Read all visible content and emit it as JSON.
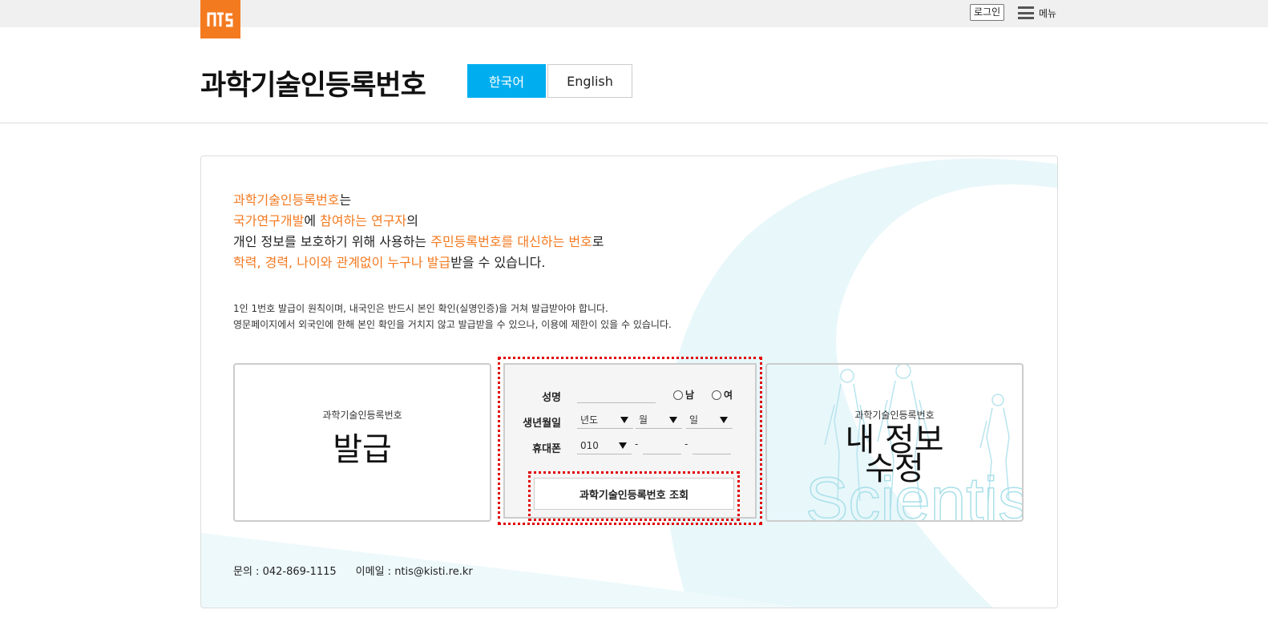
{
  "topbar": {
    "logo_text": "nTiS",
    "login_label": "로그인",
    "menu_label": "메뉴"
  },
  "header": {
    "title": "과학기술인등록번호",
    "lang_ko": "한국어",
    "lang_en": "English"
  },
  "intro": {
    "line1_highlight": "과학기술인등록번호",
    "line1_rest": "는",
    "line2_h1": "국가연구개발",
    "line2_t1": "에 ",
    "line2_h2": "참여하는 연구자",
    "line2_t2": "의",
    "line3_t1": "개인 정보를 보호하기 위해 사용하는 ",
    "line3_h1": "주민등록번호를 대신하는 번호",
    "line3_t2": "로",
    "line4_h1": "학력, 경력, 나이와 관계없이 누구나 발급",
    "line4_t1": "받을 수 있습니다."
  },
  "notice": {
    "line1": "1인 1번호 발급이 원칙이며, 내국인은 반드시 본인 확인(실명인증)을 거쳐 발급받아야 합니다.",
    "line2": "영문페이지에서 외국인에 한해 본인 확인을 거치지 않고 발급받을 수 있으나, 이용에 제한이 있을 수 있습니다."
  },
  "issue_box": {
    "small": "과학기술인등록번호",
    "big": "발급"
  },
  "form": {
    "name_label": "성명",
    "name_value": "",
    "gender_male": "남",
    "gender_female": "여",
    "birth_label": "생년월일",
    "birth_year": "년도",
    "birth_month": "월",
    "birth_day": "일",
    "phone_label": "휴대폰",
    "phone_prefix": "010",
    "phone_sep": "-",
    "phone_mid": "",
    "phone_last": "",
    "search_button": "과학기술인등록번호 조회"
  },
  "edit_box": {
    "small": "과학기술인등록번호",
    "big_line1": "내 정보",
    "big_line2": "수정",
    "watermark": "Scientis"
  },
  "footer": {
    "contact": "문의 : 042-869-1115",
    "email": "이메일 : ntis@kisti.re.kr"
  },
  "colors": {
    "accent_orange": "#f47a20",
    "lang_active": "#00aeef",
    "highlight_dotted": "#e00000",
    "deco_cyan": "#e8f7fa"
  }
}
